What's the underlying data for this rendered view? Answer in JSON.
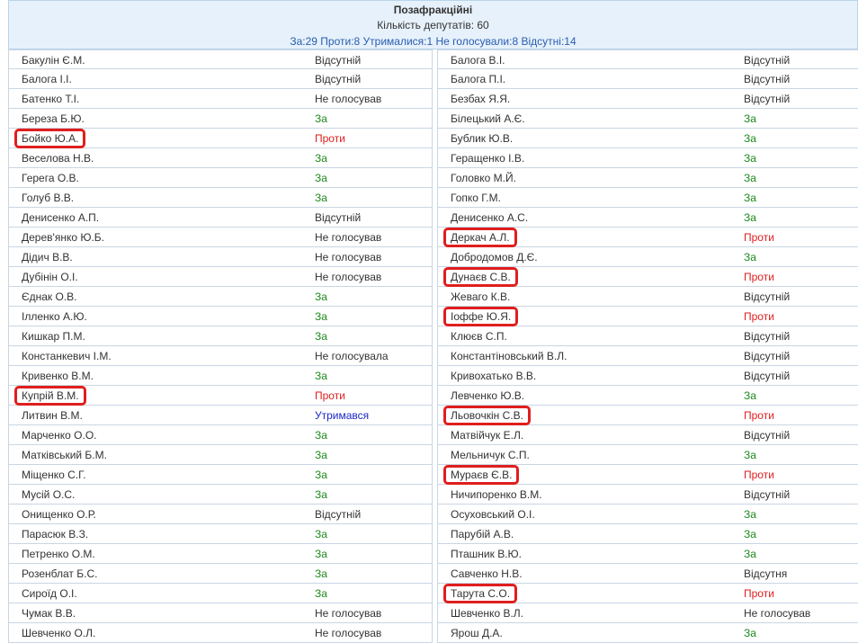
{
  "header": {
    "title": "Позафракційні",
    "count": "Кількість депутатів: 60",
    "summary": "За:29 Проти:8 Утрималися:1 Не голосували:8 Відсутні:14"
  },
  "left": [
    {
      "name": "Бакулін Є.М.",
      "vote": "Відсутній",
      "cls": "other"
    },
    {
      "name": "Балога І.І.",
      "vote": "Відсутній",
      "cls": "other"
    },
    {
      "name": "Батенко Т.І.",
      "vote": "Не голосував",
      "cls": "other"
    },
    {
      "name": "Береза Б.Ю.",
      "vote": "За",
      "cls": "za"
    },
    {
      "name": "Бойко Ю.А.",
      "vote": "Проти",
      "cls": "proty",
      "hl": true
    },
    {
      "name": "Веселова Н.В.",
      "vote": "За",
      "cls": "za"
    },
    {
      "name": "Герега О.В.",
      "vote": "За",
      "cls": "za"
    },
    {
      "name": "Голуб В.В.",
      "vote": "За",
      "cls": "za"
    },
    {
      "name": "Денисенко А.П.",
      "vote": "Відсутній",
      "cls": "other"
    },
    {
      "name": "Дерев'янко Ю.Б.",
      "vote": "Не голосував",
      "cls": "other"
    },
    {
      "name": "Дідич В.В.",
      "vote": "Не голосував",
      "cls": "other"
    },
    {
      "name": "Дубінін О.І.",
      "vote": "Не голосував",
      "cls": "other"
    },
    {
      "name": "Єднак О.В.",
      "vote": "За",
      "cls": "za"
    },
    {
      "name": "Ілленко А.Ю.",
      "vote": "За",
      "cls": "za"
    },
    {
      "name": "Кишкар П.М.",
      "vote": "За",
      "cls": "za"
    },
    {
      "name": "Констанкевич І.М.",
      "vote": "Не голосувала",
      "cls": "other"
    },
    {
      "name": "Кривенко В.М.",
      "vote": "За",
      "cls": "za"
    },
    {
      "name": "Купрій В.М.",
      "vote": "Проти",
      "cls": "proty",
      "hl": true
    },
    {
      "name": "Литвин В.М.",
      "vote": "Утримався",
      "cls": "utr"
    },
    {
      "name": "Марченко О.О.",
      "vote": "За",
      "cls": "za"
    },
    {
      "name": "Матківський Б.М.",
      "vote": "За",
      "cls": "za"
    },
    {
      "name": "Міщенко С.Г.",
      "vote": "За",
      "cls": "za"
    },
    {
      "name": "Мусій О.С.",
      "vote": "За",
      "cls": "za"
    },
    {
      "name": "Онищенко О.Р.",
      "vote": "Відсутній",
      "cls": "other"
    },
    {
      "name": "Парасюк В.З.",
      "vote": "За",
      "cls": "za"
    },
    {
      "name": "Петренко О.М.",
      "vote": "За",
      "cls": "za"
    },
    {
      "name": "Розенблат Б.С.",
      "vote": "За",
      "cls": "za"
    },
    {
      "name": "Сироїд О.І.",
      "vote": "За",
      "cls": "za"
    },
    {
      "name": "Чумак В.В.",
      "vote": "Не голосував",
      "cls": "other"
    },
    {
      "name": "Шевченко О.Л.",
      "vote": "Не голосував",
      "cls": "other"
    }
  ],
  "right": [
    {
      "name": "Балога В.І.",
      "vote": "Відсутній",
      "cls": "other"
    },
    {
      "name": "Балога П.І.",
      "vote": "Відсутній",
      "cls": "other"
    },
    {
      "name": "Безбах Я.Я.",
      "vote": "Відсутній",
      "cls": "other"
    },
    {
      "name": "Білецький А.Є.",
      "vote": "За",
      "cls": "za"
    },
    {
      "name": "Бублик Ю.В.",
      "vote": "За",
      "cls": "za"
    },
    {
      "name": "Геращенко І.В.",
      "vote": "За",
      "cls": "za"
    },
    {
      "name": "Головко М.Й.",
      "vote": "За",
      "cls": "za"
    },
    {
      "name": "Гопко Г.М.",
      "vote": "За",
      "cls": "za"
    },
    {
      "name": "Денисенко А.С.",
      "vote": "За",
      "cls": "za"
    },
    {
      "name": "Деркач А.Л.",
      "vote": "Проти",
      "cls": "proty",
      "hl": true
    },
    {
      "name": "Добродомов Д.Є.",
      "vote": "За",
      "cls": "za"
    },
    {
      "name": "Дунаєв С.В.",
      "vote": "Проти",
      "cls": "proty",
      "hl": true
    },
    {
      "name": "Жеваго К.В.",
      "vote": "Відсутній",
      "cls": "other"
    },
    {
      "name": "Іоффе Ю.Я.",
      "vote": "Проти",
      "cls": "proty",
      "hl": true
    },
    {
      "name": "Клюєв С.П.",
      "vote": "Відсутній",
      "cls": "other"
    },
    {
      "name": "Константіновський В.Л.",
      "vote": "Відсутній",
      "cls": "other"
    },
    {
      "name": "Кривохатько В.В.",
      "vote": "Відсутній",
      "cls": "other"
    },
    {
      "name": "Левченко Ю.В.",
      "vote": "За",
      "cls": "za"
    },
    {
      "name": "Льовочкін С.В.",
      "vote": "Проти",
      "cls": "proty",
      "hl": true
    },
    {
      "name": "Матвійчук Е.Л.",
      "vote": "Відсутній",
      "cls": "other"
    },
    {
      "name": "Мельничук С.П.",
      "vote": "За",
      "cls": "za"
    },
    {
      "name": "Мураєв Є.В.",
      "vote": "Проти",
      "cls": "proty",
      "hl": true
    },
    {
      "name": "Ничипоренко В.М.",
      "vote": "Відсутній",
      "cls": "other"
    },
    {
      "name": "Осуховський О.І.",
      "vote": "За",
      "cls": "za"
    },
    {
      "name": "Парубій А.В.",
      "vote": "За",
      "cls": "za"
    },
    {
      "name": "Пташник В.Ю.",
      "vote": "За",
      "cls": "za"
    },
    {
      "name": "Савченко Н.В.",
      "vote": "Відсутня",
      "cls": "other"
    },
    {
      "name": "Тарута С.О.",
      "vote": "Проти",
      "cls": "proty",
      "hl": true
    },
    {
      "name": "Шевченко В.Л.",
      "vote": "Не голосував",
      "cls": "other"
    },
    {
      "name": "Ярош Д.А.",
      "vote": "За",
      "cls": "za"
    }
  ]
}
